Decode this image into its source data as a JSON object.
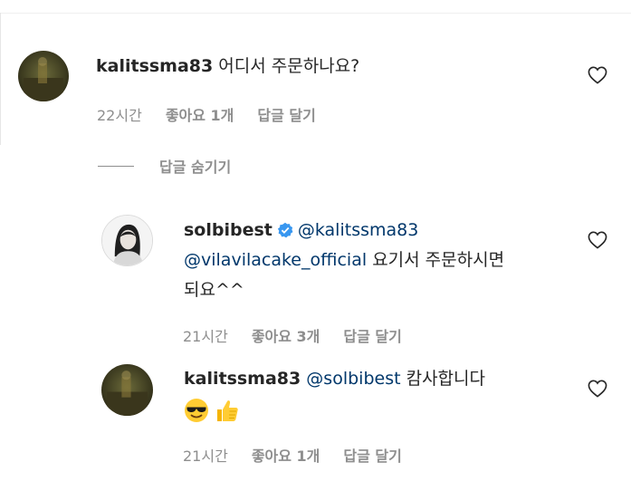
{
  "comments": [
    {
      "username": "kalitssma83",
      "text": "어디서 주문하나요?",
      "time": "22시간",
      "likes": "좋아요 1개",
      "reply": "답글 달기"
    }
  ],
  "hide_replies_label": "답글 숨기기",
  "replies": [
    {
      "username": "solbibest",
      "mention1": "@kalitssma83",
      "mention2": "@vilavilacake_official",
      "text_line2": "요기서 주문하시면",
      "text_line3": "되요^^",
      "time": "21시간",
      "likes": "좋아요 3개",
      "reply": "답글 달기"
    },
    {
      "username": "kalitssma83",
      "mention": "@solbibest",
      "text": "캄사합니다",
      "time": "21시간",
      "likes": "좋아요 1개",
      "reply": "답글 달기"
    }
  ],
  "icons": {
    "like": "heart-outline-icon",
    "verified": "verified-badge-icon",
    "emoji_1": "smiling-face-with-sunglasses-emoji",
    "emoji_2": "thumbs-up-emoji"
  },
  "colors": {
    "text": "#262626",
    "secondary": "#8e8e8e",
    "mention": "#00376b",
    "verified": "#3897f0"
  }
}
